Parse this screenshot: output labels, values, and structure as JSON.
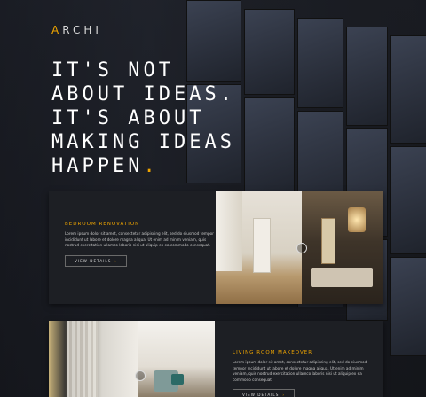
{
  "brand": {
    "logo_first": "A",
    "logo_rest": "RCHI",
    "accent": "#f0a500"
  },
  "hero": {
    "line1": "IT'S NOT",
    "line2": "ABOUT IDEAS.",
    "line3": "IT'S ABOUT",
    "line4": "MAKING IDEAS",
    "line5": "HAPPEN",
    "line5_dot": "."
  },
  "projects": [
    {
      "title": "BEDROOM RENOVATION",
      "description": "Lorem ipsum dolor sit amet, consectetur adipiscing elit, sed do eiusmod tempor incididunt ut labore et dolore magna aliqua. Ut enim ad minim veniam, quis nostrud exercitation ullamco laboris nisi ut aliquip ex ea commodo consequat.",
      "button_label": "VIEW DETAILS",
      "button_icon": "chevron-right-icon"
    },
    {
      "title": "LIVING ROOM MAKEOVER",
      "description": "Lorem ipsum dolor sit amet, consectetur adipiscing elit, sed do eiusmod tempor incididunt ut labore et dolore magna aliqua. Ut enim ad minim veniam, quis nostrud exercitation ullamco laboris nisi ut aliquip ex ea commodo consequat.",
      "button_label": "VIEW DETAILS",
      "button_icon": "chevron-right-icon"
    }
  ]
}
